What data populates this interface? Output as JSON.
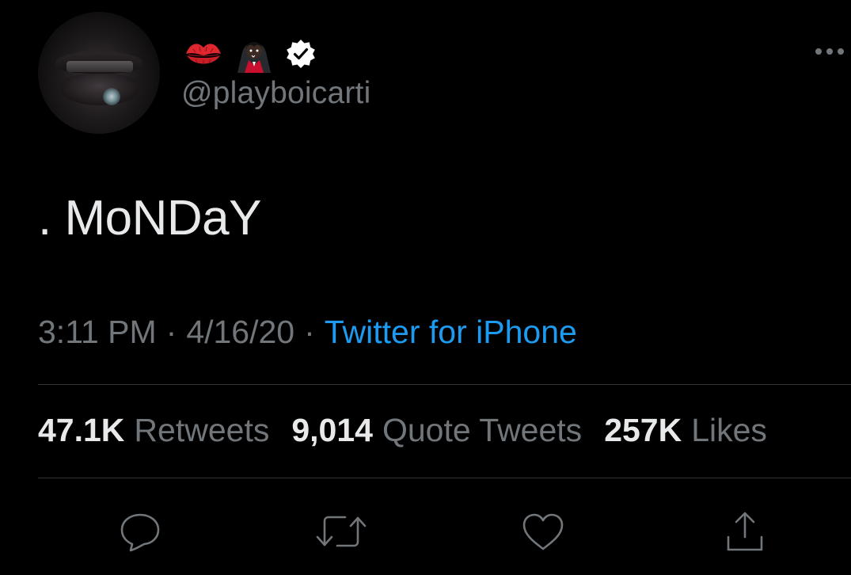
{
  "tweet": {
    "author": {
      "handle": "@playboicarti",
      "name_emojis": [
        "kiss-mark-icon",
        "vampire-icon"
      ],
      "verified": true
    },
    "text": ". MoNDaY",
    "time": "3:11 PM",
    "date": "4/16/20",
    "separator": "·",
    "source": "Twitter for iPhone"
  },
  "stats": {
    "retweets_value": "47.1K",
    "retweets_label": "Retweets",
    "quotes_value": "9,014",
    "quotes_label": "Quote Tweets",
    "likes_value": "257K",
    "likes_label": "Likes"
  },
  "actions": [
    "reply-icon",
    "retweet-icon",
    "like-icon",
    "share-icon"
  ],
  "colors": {
    "background": "#000000",
    "text_primary": "#e7e9ea",
    "text_secondary": "#71767b",
    "link": "#1d9bf0",
    "divider": "#2f3336"
  }
}
